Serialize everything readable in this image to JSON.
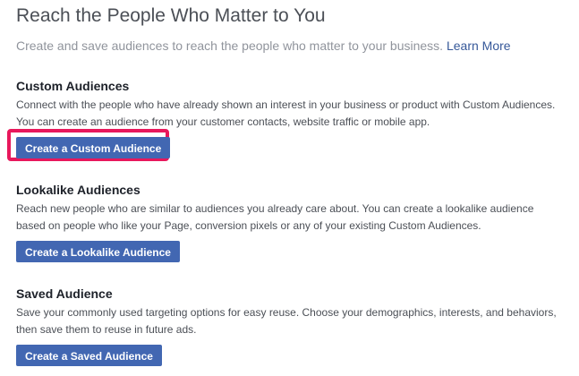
{
  "header": {
    "title": "Reach the People Who Matter to You",
    "subtitle": "Create and save audiences to reach the people who matter to your business.",
    "learn_more": "Learn More"
  },
  "sections": {
    "custom": {
      "title": "Custom Audiences",
      "description": "Connect with the people who have already shown an interest in your business or product with Custom Audiences. You can create an audience from your customer contacts, website traffic or mobile app.",
      "button": "Create a Custom Audience"
    },
    "lookalike": {
      "title": "Lookalike Audiences",
      "description": "Reach new people who are similar to audiences you already care about. You can create a lookalike audience based on people who like your Page, conversion pixels or any of your existing Custom Audiences.",
      "button": "Create a Lookalike Audience"
    },
    "saved": {
      "title": "Saved Audience",
      "description": "Save your commonly used targeting options for easy reuse. Choose your demographics, interests, and behaviors, then save them to reuse in future ads.",
      "button": "Create a Saved Audience"
    }
  },
  "colors": {
    "button_bg": "#4267b2",
    "link": "#365899",
    "highlight": "#e8185c"
  }
}
